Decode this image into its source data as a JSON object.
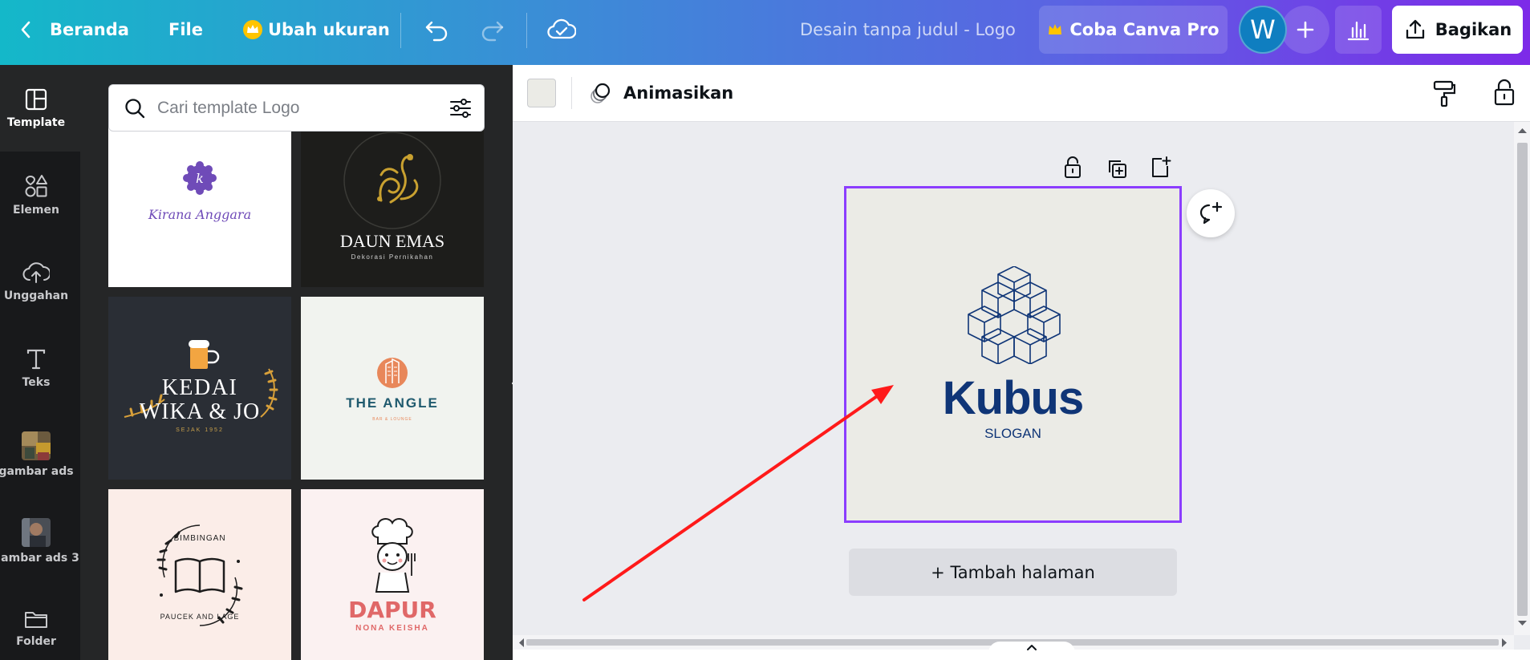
{
  "topbar": {
    "home_label": "Beranda",
    "file_label": "File",
    "resize_label": "Ubah ukuran",
    "doc_title": "Desain tanpa judul - Logo",
    "pro_label": "Coba Canva Pro",
    "avatar_initial": "W",
    "share_label": "Bagikan"
  },
  "rail": {
    "items": [
      {
        "label": "Template"
      },
      {
        "label": "Elemen"
      },
      {
        "label": "Unggahan"
      },
      {
        "label": "Teks"
      },
      {
        "label": "gambar ads"
      },
      {
        "label": "gambar ads 3"
      },
      {
        "label": "Folder"
      }
    ]
  },
  "search": {
    "placeholder": "Cari template Logo"
  },
  "templates": [
    {
      "name": "Kirana Anggara",
      "initial": "k"
    },
    {
      "name": "DAUN EMAS",
      "sub": "Dekorasi Pernikahan"
    },
    {
      "name_line1": "KEDAI",
      "name_line2": "WIKA & JO",
      "sub": "SEJAK 1952"
    },
    {
      "name": "THE ANGLE",
      "sub": "BAR & LOUNGE"
    },
    {
      "arc_top": "BIMBINGAN",
      "arc_bottom": "PAUCEK AND LAGE"
    },
    {
      "name": "DAPUR",
      "sub": "NONA KEISHA"
    }
  ],
  "context_bar": {
    "animate_label": "Animasikan"
  },
  "design": {
    "brand": "Kubus",
    "slogan": "SLOGAN"
  },
  "add_page_label": "+ Tambah halaman",
  "colors": {
    "accent_purple": "#8b3dff",
    "logo_navy": "#0f3577",
    "annotation_red": "#ff1a1a"
  }
}
